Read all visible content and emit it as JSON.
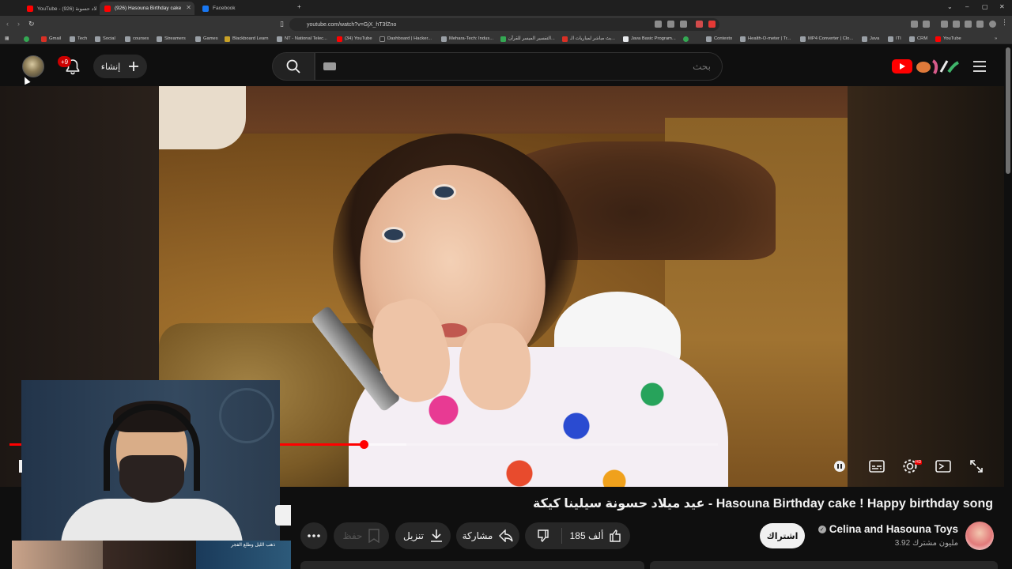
{
  "browser": {
    "tabs": [
      {
        "label": "YouTube - عيد ميلاد حسونة (926)",
        "favicon_color": "#ff0000"
      },
      {
        "label": "(926) Hasouna Birthday cake",
        "favicon_color": "#ff0000"
      },
      {
        "label": "Facebook",
        "favicon_color": "#1877f2"
      }
    ],
    "new_tab": "+",
    "window_controls": [
      "⌄",
      "–",
      "▢",
      "✕"
    ],
    "url": "youtube.com/watch?v=GjX_hT3fZno"
  },
  "bookmarks": [
    {
      "label": "Gmail",
      "color": "#d93025"
    },
    {
      "label": "Tech",
      "color": "#9aa0a6"
    },
    {
      "label": "Social",
      "color": "#9aa0a6"
    },
    {
      "label": "courses",
      "color": "#9aa0a6"
    },
    {
      "label": "Streamers",
      "color": "#9aa0a6"
    },
    {
      "label": "Games",
      "color": "#9aa0a6"
    },
    {
      "label": "Blackboard Learn",
      "color": "#c9a227"
    },
    {
      "label": "NT - National Telec...",
      "color": "#9aa0a6"
    },
    {
      "label": "(34) YouTube",
      "color": "#ff0000"
    },
    {
      "label": "Dashboard | Hacker...",
      "color": "#2b2b2b"
    },
    {
      "label": "Mehara-Tech: Indus...",
      "color": "#9aa0a6"
    },
    {
      "label": "التفسير الميسر للقرآن...",
      "color": "#34a853"
    },
    {
      "label": "بث مباشر لمباريات الـ...",
      "color": "#d93025"
    },
    {
      "label": "Java Basic Program...",
      "color": "#e8eaed"
    },
    {
      "label": "Contexto",
      "color": "#9aa0a6"
    },
    {
      "label": "Health-O-meter | Tr...",
      "color": "#9aa0a6"
    },
    {
      "label": "MP4 Converter | Clo...",
      "color": "#9aa0a6"
    },
    {
      "label": "Java",
      "color": "#9aa0a6"
    },
    {
      "label": "ITI",
      "color": "#9aa0a6"
    },
    {
      "label": "CRM",
      "color": "#9aa0a6"
    },
    {
      "label": "YouTube",
      "color": "#ff0000"
    }
  ],
  "youtube": {
    "notification_count": "+9",
    "create_label": "إنشاء",
    "search_placeholder": "بحث",
    "accent": "#ff0000"
  },
  "player": {
    "progress_fraction": 0.5,
    "buffer_fraction": 0.56,
    "hd_badge": "HD"
  },
  "video": {
    "title": "عيد ميلاد حسونة سيلينا كيكة - Hasouna Birthday cake ! Happy birthday song",
    "channel": "Celina and Hasouna Toys",
    "subscribers": "3.92 مليون مشترك",
    "subscribe_label": "اشتراك",
    "likes": "185 ألف",
    "share_label": "مشاركة",
    "download_label": "تنزيل",
    "save_label": "حفظ",
    "thumb_caption": "ذهب الليل وطلع الفجر"
  }
}
